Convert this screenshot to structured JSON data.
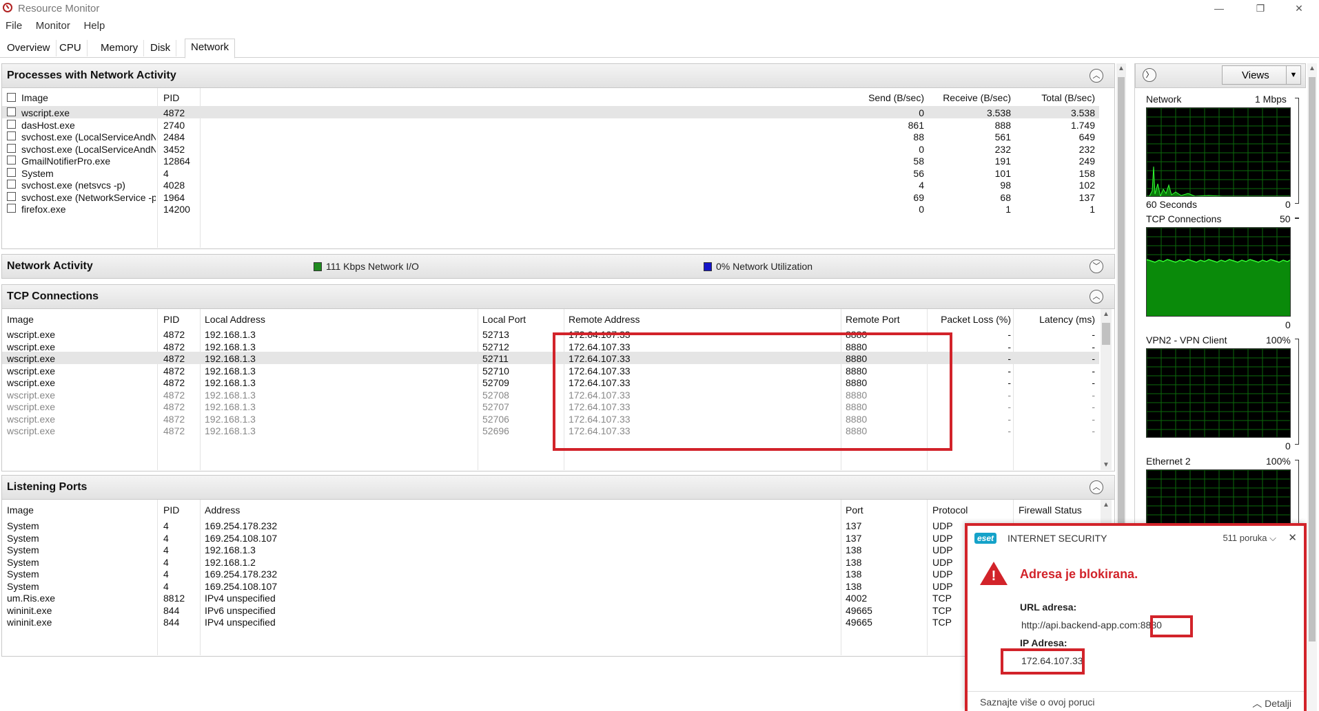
{
  "window": {
    "title": "Resource Monitor",
    "minimize": "—",
    "restore": "❐",
    "close": "✕"
  },
  "menu": [
    "File",
    "Monitor",
    "Help"
  ],
  "tabs": [
    "Overview",
    "CPU",
    "Memory",
    "Disk",
    "Network"
  ],
  "active_tab": "Network",
  "processes": {
    "title": "Processes with Network Activity",
    "columns": [
      "Image",
      "PID",
      "Send (B/sec)",
      "Receive (B/sec)",
      "Total (B/sec)"
    ],
    "rows": [
      {
        "image": "wscript.exe",
        "pid": "4872",
        "send": "0",
        "receive": "3.538",
        "total": "3.538",
        "selected": true
      },
      {
        "image": "dasHost.exe",
        "pid": "2740",
        "send": "861",
        "receive": "888",
        "total": "1.749"
      },
      {
        "image": "svchost.exe (LocalServiceAndN...",
        "pid": "2484",
        "send": "88",
        "receive": "561",
        "total": "649"
      },
      {
        "image": "svchost.exe (LocalServiceAndN...",
        "pid": "3452",
        "send": "0",
        "receive": "232",
        "total": "232"
      },
      {
        "image": "GmailNotifierPro.exe",
        "pid": "12864",
        "send": "58",
        "receive": "191",
        "total": "249"
      },
      {
        "image": "System",
        "pid": "4",
        "send": "56",
        "receive": "101",
        "total": "158"
      },
      {
        "image": "svchost.exe (netsvcs -p)",
        "pid": "4028",
        "send": "4",
        "receive": "98",
        "total": "102"
      },
      {
        "image": "svchost.exe (NetworkService -p)",
        "pid": "1964",
        "send": "69",
        "receive": "68",
        "total": "137"
      },
      {
        "image": "firefox.exe",
        "pid": "14200",
        "send": "0",
        "receive": "1",
        "total": "1"
      }
    ]
  },
  "network_activity": {
    "title": "Network Activity",
    "io_label": "111 Kbps Network I/O",
    "util_label": "0% Network Utilization",
    "io_color": "#1f8a1f",
    "util_color": "#1515c8"
  },
  "tcp": {
    "title": "TCP Connections",
    "columns": [
      "Image",
      "PID",
      "Local Address",
      "Local Port",
      "Remote Address",
      "Remote Port",
      "Packet Loss (%)",
      "Latency (ms)"
    ],
    "rows": [
      {
        "image": "wscript.exe",
        "pid": "4872",
        "local": "192.168.1.3",
        "lport": "52713",
        "remote": "172.64.107.33",
        "rport": "8880",
        "loss": "-",
        "latency": "-"
      },
      {
        "image": "wscript.exe",
        "pid": "4872",
        "local": "192.168.1.3",
        "lport": "52712",
        "remote": "172.64.107.33",
        "rport": "8880",
        "loss": "-",
        "latency": "-"
      },
      {
        "image": "wscript.exe",
        "pid": "4872",
        "local": "192.168.1.3",
        "lport": "52711",
        "remote": "172.64.107.33",
        "rport": "8880",
        "loss": "-",
        "latency": "-",
        "selected": true
      },
      {
        "image": "wscript.exe",
        "pid": "4872",
        "local": "192.168.1.3",
        "lport": "52710",
        "remote": "172.64.107.33",
        "rport": "8880",
        "loss": "-",
        "latency": "-"
      },
      {
        "image": "wscript.exe",
        "pid": "4872",
        "local": "192.168.1.3",
        "lport": "52709",
        "remote": "172.64.107.33",
        "rport": "8880",
        "loss": "-",
        "latency": "-"
      },
      {
        "image": "wscript.exe",
        "pid": "4872",
        "local": "192.168.1.3",
        "lport": "52708",
        "remote": "172.64.107.33",
        "rport": "8880",
        "loss": "-",
        "latency": "-",
        "dim": true
      },
      {
        "image": "wscript.exe",
        "pid": "4872",
        "local": "192.168.1.3",
        "lport": "52707",
        "remote": "172.64.107.33",
        "rport": "8880",
        "loss": "-",
        "latency": "-",
        "dim": true
      },
      {
        "image": "wscript.exe",
        "pid": "4872",
        "local": "192.168.1.3",
        "lport": "52706",
        "remote": "172.64.107.33",
        "rport": "8880",
        "loss": "-",
        "latency": "-",
        "dim": true
      },
      {
        "image": "wscript.exe",
        "pid": "4872",
        "local": "192.168.1.3",
        "lport": "52696",
        "remote": "172.64.107.33",
        "rport": "8880",
        "loss": "-",
        "latency": "-",
        "dim": true
      }
    ]
  },
  "listening": {
    "title": "Listening Ports",
    "columns": [
      "Image",
      "PID",
      "Address",
      "Port",
      "Protocol",
      "Firewall Status"
    ],
    "rows": [
      {
        "image": "System",
        "pid": "4",
        "address": "169.254.178.232",
        "port": "137",
        "protocol": "UDP"
      },
      {
        "image": "System",
        "pid": "4",
        "address": "169.254.108.107",
        "port": "137",
        "protocol": "UDP"
      },
      {
        "image": "System",
        "pid": "4",
        "address": "192.168.1.3",
        "port": "138",
        "protocol": "UDP"
      },
      {
        "image": "System",
        "pid": "4",
        "address": "192.168.1.2",
        "port": "138",
        "protocol": "UDP"
      },
      {
        "image": "System",
        "pid": "4",
        "address": "169.254.178.232",
        "port": "138",
        "protocol": "UDP"
      },
      {
        "image": "System",
        "pid": "4",
        "address": "169.254.108.107",
        "port": "138",
        "protocol": "UDP"
      },
      {
        "image": "um.Ris.exe",
        "pid": "8812",
        "address": "IPv4 unspecified",
        "port": "4002",
        "protocol": "TCP"
      },
      {
        "image": "wininit.exe",
        "pid": "844",
        "address": "IPv6 unspecified",
        "port": "49665",
        "protocol": "TCP"
      },
      {
        "image": "wininit.exe",
        "pid": "844",
        "address": "IPv4 unspecified",
        "port": "49665",
        "protocol": "TCP"
      }
    ]
  },
  "right_panel": {
    "views_label": "Views",
    "graphs": [
      {
        "label": "Network",
        "max": "1 Mbps",
        "bottom_left": "60 Seconds",
        "bottom_right": "0"
      },
      {
        "label": "TCP Connections",
        "max": "50",
        "bottom_right": "0"
      },
      {
        "label": "VPN2 - VPN Client",
        "max": "100%",
        "bottom_right": "0"
      },
      {
        "label": "Ethernet 2",
        "max": "100%"
      }
    ]
  },
  "eset": {
    "logo": "eset",
    "product": "INTERNET SECURITY",
    "count": "511 poruka",
    "title": "Adresa je blokirana.",
    "url_label": "URL adresa:",
    "url_value": "http://api.backend-app.com:8880",
    "ip_label": "IP Adresa:",
    "ip_value": "172.64.107.33",
    "more": "Saznajte više o ovoj poruci",
    "details": "Detalji"
  }
}
